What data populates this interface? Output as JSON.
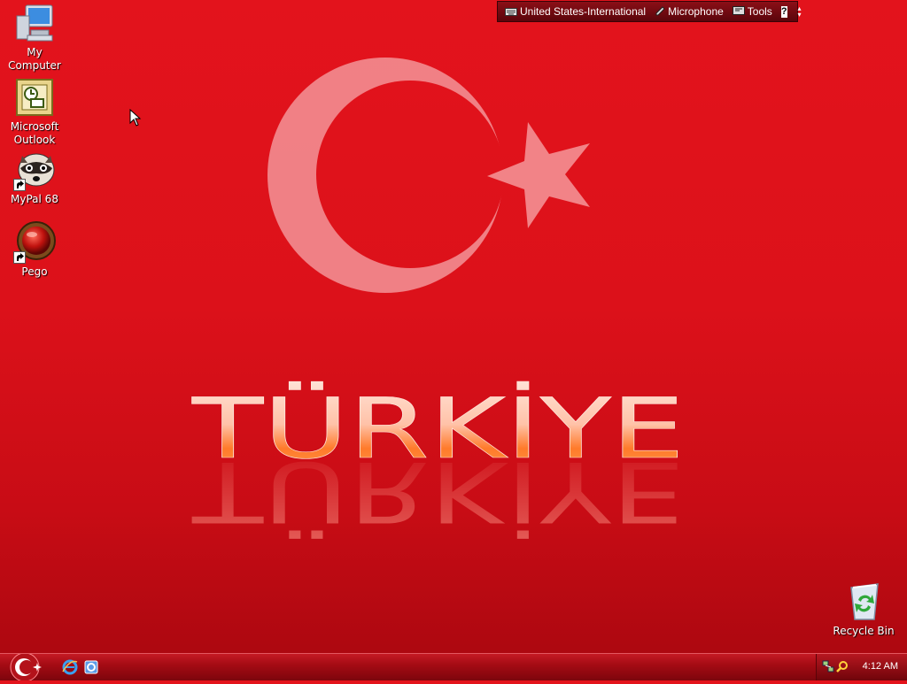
{
  "desktop": {
    "icons": [
      {
        "label": "My Computer",
        "icon": "computer-icon"
      },
      {
        "label": "Microsoft Outlook",
        "icon": "outlook-icon"
      },
      {
        "label": "MyPal 68",
        "icon": "raccoon-browser-icon"
      },
      {
        "label": "Pego",
        "icon": "red-orb-icon"
      },
      {
        "label": "Recycle Bin",
        "icon": "recycle-bin-icon"
      }
    ],
    "wallpaper_text": "TÜRKİYE"
  },
  "language_bar": {
    "language": "United States-International",
    "microphone": "Microphone",
    "tools": "Tools",
    "help": "?"
  },
  "taskbar": {
    "start_icon": "crescent-start-icon",
    "quick_launch": [
      "internet-explorer-icon",
      "outlook-express-icon"
    ],
    "tray_icons": [
      "network-icon",
      "search-icon"
    ],
    "clock": "4:12 AM"
  },
  "colors": {
    "background": "#dc111a",
    "taskbar": "#a50b14",
    "accent": "#ff7a2a"
  }
}
